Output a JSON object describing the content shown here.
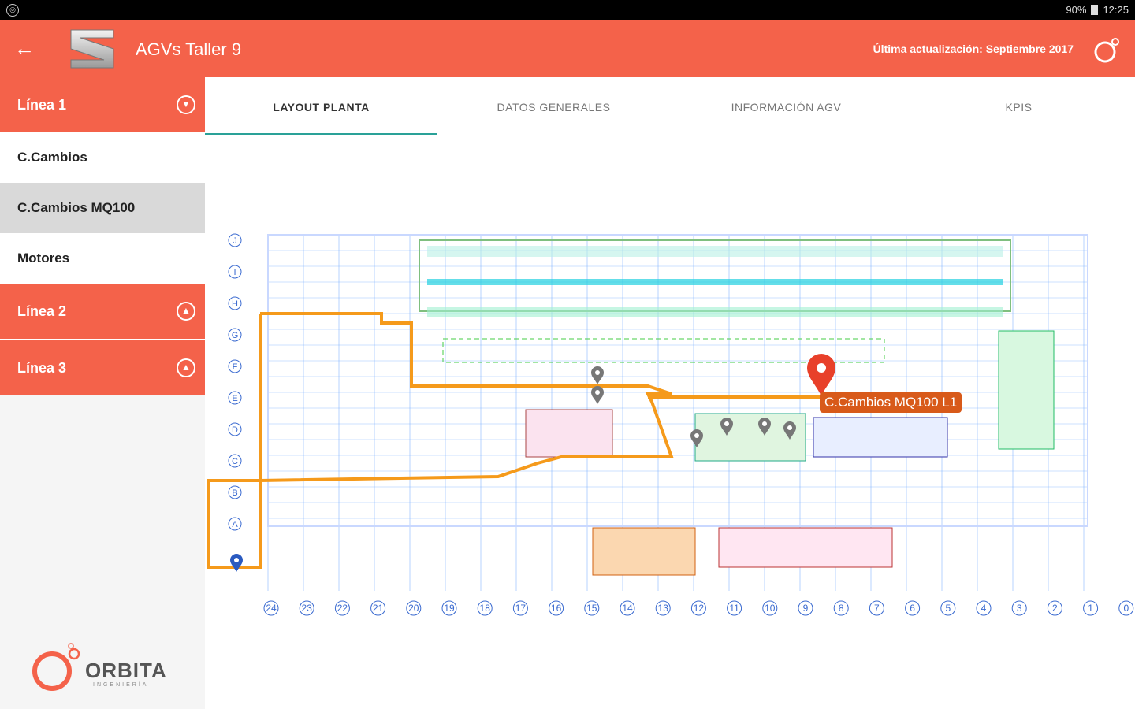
{
  "statusbar": {
    "battery": "90%",
    "time": "12:25"
  },
  "header": {
    "title": "AGVs Taller 9",
    "last_update": "Última actualización: Septiembre 2017"
  },
  "sidebar": {
    "line1": "Línea 1",
    "items": [
      "C.Cambios",
      "C.Cambios MQ100",
      "Motores"
    ],
    "line2": "Línea 2",
    "line3": "Línea 3",
    "brand": "ORBITA",
    "brand_sub": "INGENIERÍA"
  },
  "tabs": [
    "LAYOUT PLANTA",
    "DATOS GENERALES",
    "INFORMACIÓN AGV",
    "KPIS"
  ],
  "map": {
    "selected_pin_label": "C.Cambios MQ100 L1",
    "col_numbers": [
      "24",
      "23",
      "22",
      "21",
      "20",
      "19",
      "18",
      "17",
      "16",
      "15",
      "14",
      "13",
      "12",
      "11",
      "10",
      "9",
      "8",
      "7",
      "6",
      "5",
      "4",
      "3",
      "2",
      "1",
      "0"
    ],
    "row_letters": [
      "J",
      "I",
      "H",
      "G",
      "F",
      "E",
      "D",
      "C",
      "B",
      "A"
    ]
  },
  "colors": {
    "accent": "#f4624a",
    "route": "#f59a1b",
    "pin": "#e8402a",
    "tab_underline": "#2aa198"
  }
}
